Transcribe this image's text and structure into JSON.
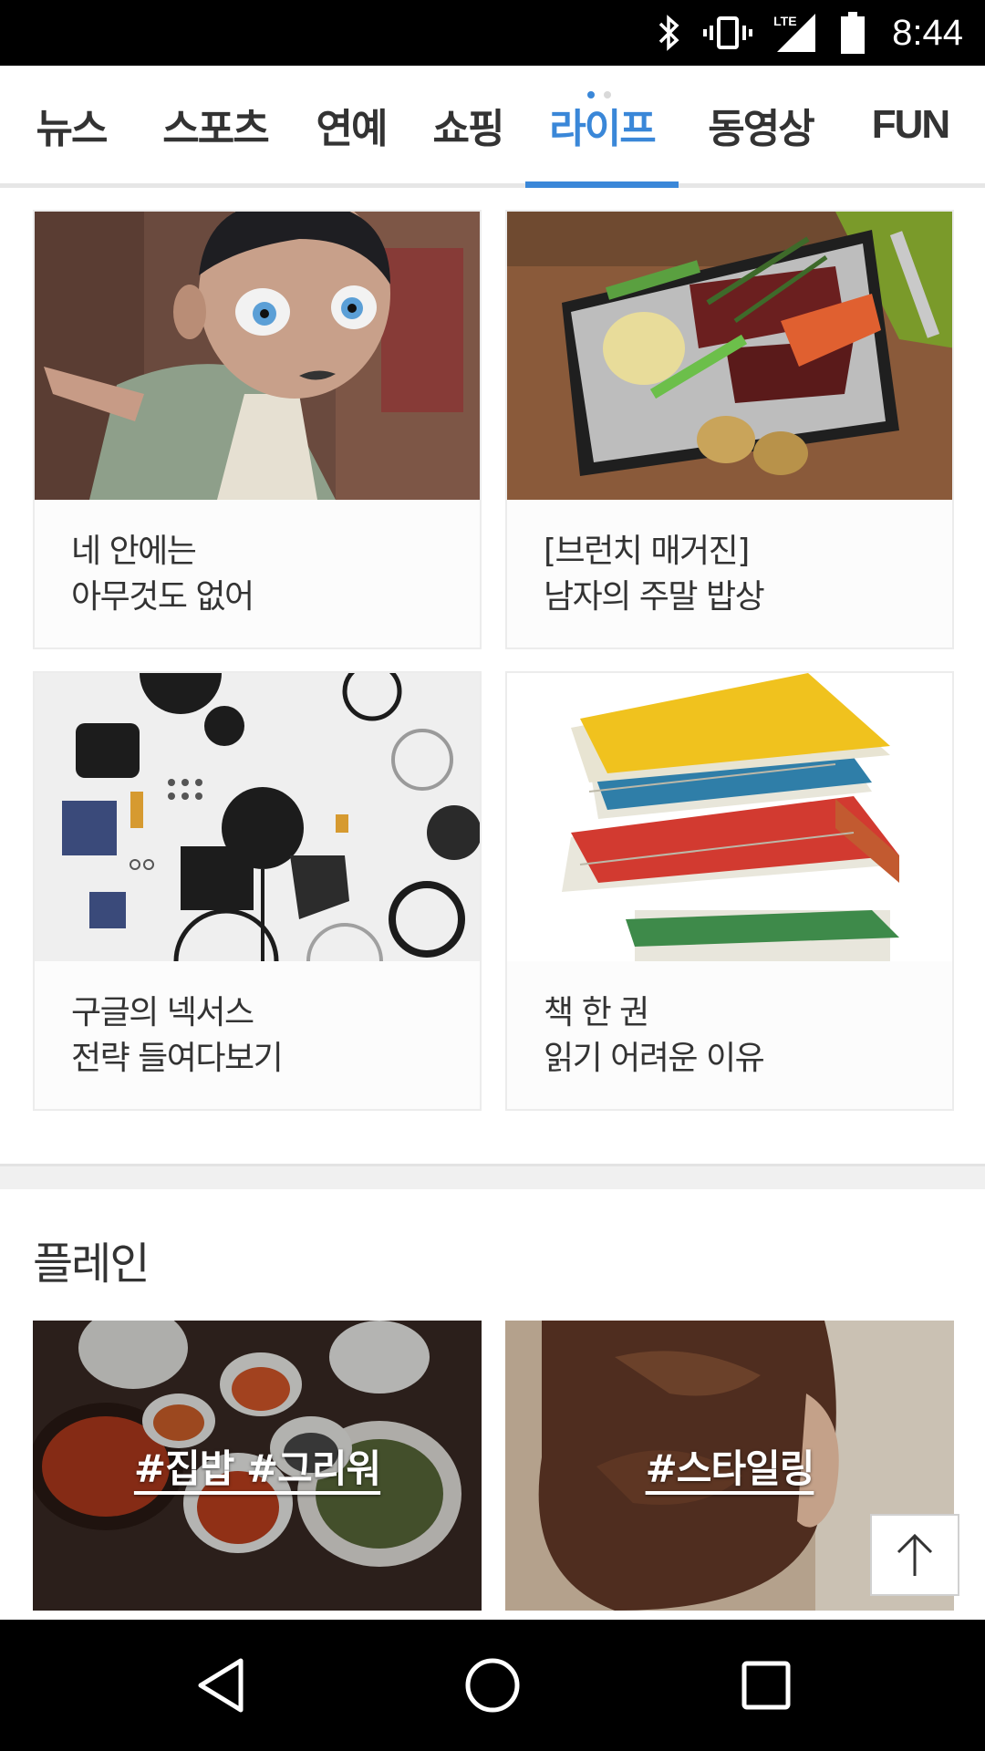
{
  "status_bar": {
    "time": "8:44",
    "network_label": "LTE",
    "icons": [
      "bluetooth-icon",
      "vibrate-icon",
      "signal-icon",
      "battery-icon"
    ]
  },
  "tabs": [
    {
      "label": "뉴스",
      "active": false
    },
    {
      "label": "스포츠",
      "active": false
    },
    {
      "label": "연예",
      "active": false
    },
    {
      "label": "쇼핑",
      "active": false
    },
    {
      "label": "라이프",
      "active": true
    },
    {
      "label": "동영상",
      "active": false
    },
    {
      "label": "FUN",
      "active": false
    }
  ],
  "accent_color": "#3a87d8",
  "cards": [
    {
      "line1": "네 안에는",
      "line2": "아무것도 없어",
      "image": "mask-head-photo"
    },
    {
      "line1": "[브런치 매거진]",
      "line2": "남자의 주말 밥상",
      "image": "grilled-meat-vegetables-photo"
    },
    {
      "line1": "구글의 넥서스",
      "line2": "전략 들여다보기",
      "image": "device-parts-photo"
    },
    {
      "line1": "책 한 권",
      "line2": "읽기 어려운 이유",
      "image": "book-stack-photo"
    }
  ],
  "plain_section": {
    "title": "플레인",
    "tiles": [
      {
        "tag": "#집밥 #그리워",
        "image": "korean-meal-photo"
      },
      {
        "tag": "#스타일링",
        "image": "hair-styling-photo"
      }
    ]
  },
  "nav_bar": {
    "buttons": [
      "back-icon",
      "home-icon",
      "recents-icon"
    ]
  }
}
